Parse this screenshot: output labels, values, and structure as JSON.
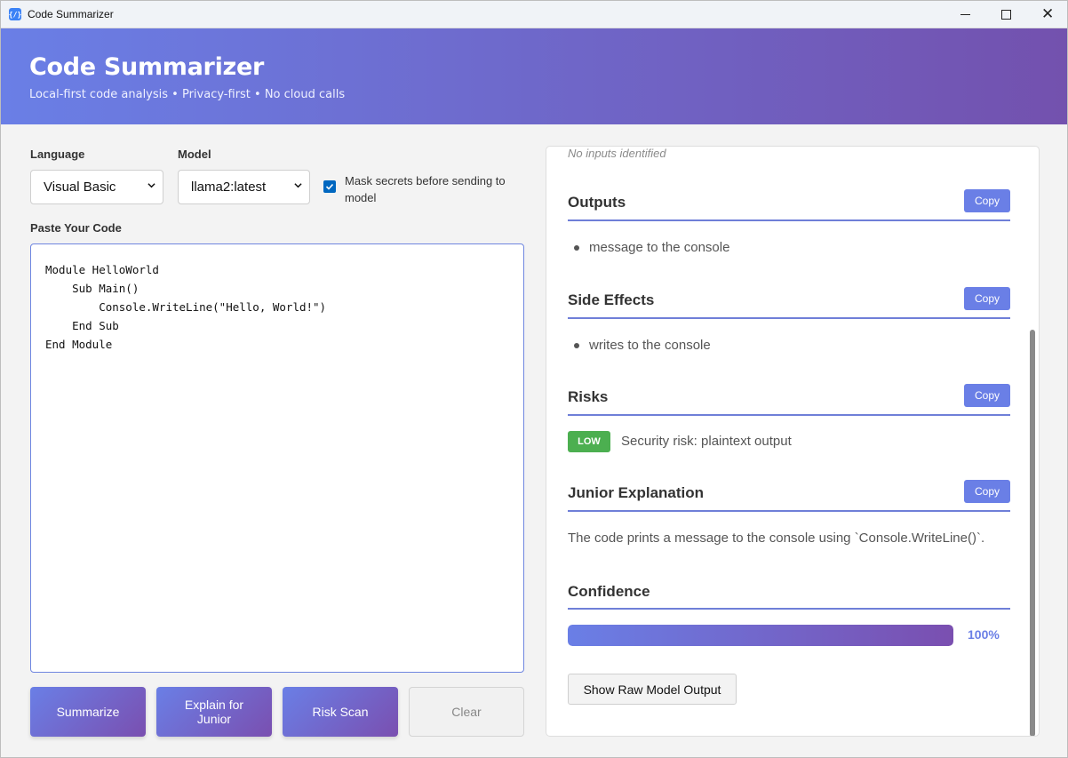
{
  "window": {
    "title": "Code Summarizer"
  },
  "header": {
    "title": "Code Summarizer",
    "subtitle": "Local-first code analysis • Privacy-first • No cloud calls"
  },
  "form": {
    "language_label": "Language",
    "language_value": "Visual Basic",
    "model_label": "Model",
    "model_value": "llama2:latest",
    "mask_label": "Mask secrets before sending to model",
    "mask_checked": true,
    "code_label": "Paste Your Code",
    "code": "Module HelloWorld\n    Sub Main()\n        Console.WriteLine(\"Hello, World!\")\n    End Sub\nEnd Module"
  },
  "actions": {
    "summarize": "Summarize",
    "explain": "Explain for Junior",
    "risk_scan": "Risk Scan",
    "clear": "Clear"
  },
  "results": {
    "inputs_empty": "No inputs identified",
    "copy_label": "Copy",
    "outputs": {
      "title": "Outputs",
      "items": [
        "message to the console"
      ]
    },
    "side_effects": {
      "title": "Side Effects",
      "items": [
        "writes to the console"
      ]
    },
    "risks": {
      "title": "Risks",
      "level": "LOW",
      "text": "Security risk: plaintext output"
    },
    "junior": {
      "title": "Junior Explanation",
      "text": "The code prints a message to the console using `Console.WriteLine()`."
    },
    "confidence": {
      "title": "Confidence",
      "value": 1.0,
      "label": "100%"
    },
    "raw_button": "Show Raw Model Output"
  },
  "colors": {
    "accent": "#6a7fe6",
    "accent_dark": "#7351ae",
    "risk_low": "#4caf50"
  }
}
